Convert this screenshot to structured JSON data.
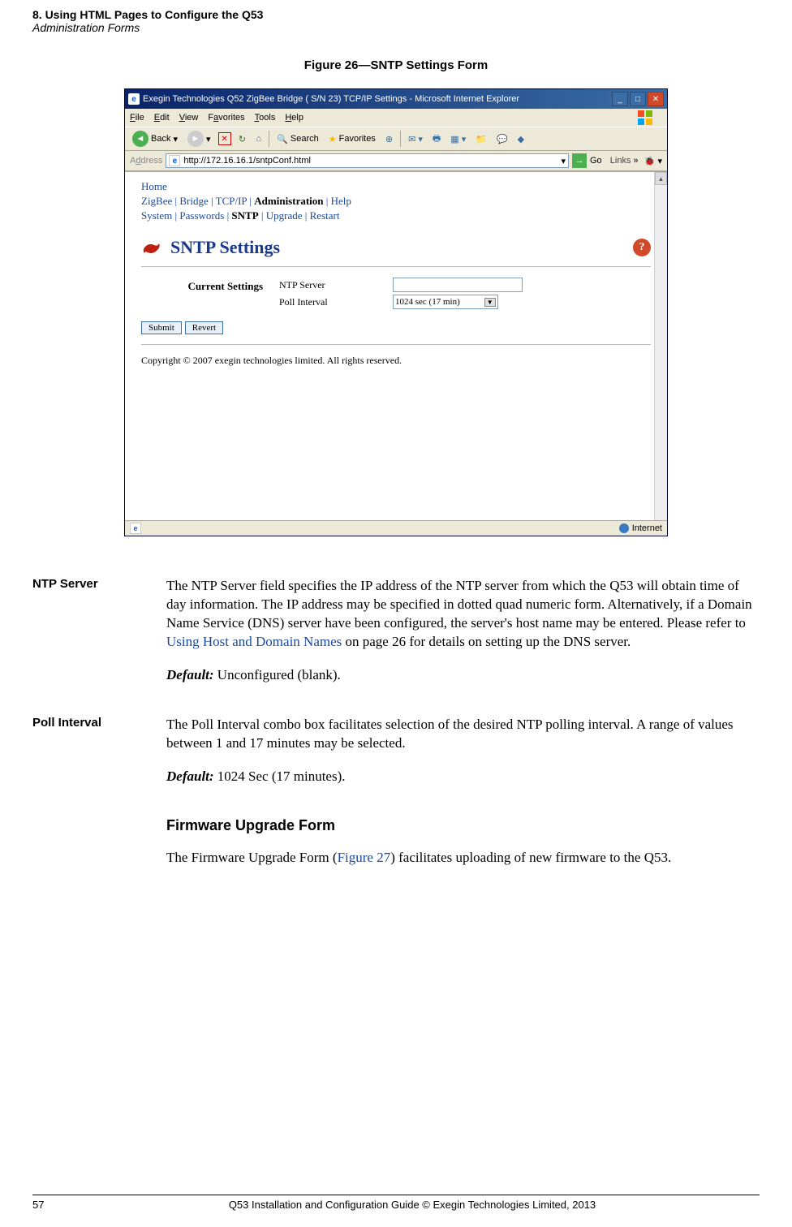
{
  "header": {
    "title": "8. Using HTML Pages to Configure the Q53",
    "subtitle": "Administration Forms"
  },
  "figure_caption": "Figure 26—SNTP Settings Form",
  "ie": {
    "title": "Exegin Technologies Q52 ZigBee Bridge ( S/N 23) TCP/IP Settings - Microsoft Internet Explorer",
    "menu": {
      "file": "File",
      "edit": "Edit",
      "view": "View",
      "favorites": "Favorites",
      "tools": "Tools",
      "help": "Help"
    },
    "toolbar": {
      "back": "Back",
      "search": "Search",
      "favorites": "Favorites"
    },
    "addr": {
      "label": "Address",
      "url": "http://172.16.16.1/sntpConf.html",
      "go": "Go",
      "links": "Links"
    },
    "nav1": {
      "home": "Home"
    },
    "nav2": {
      "zigbee": "ZigBee",
      "bridge": "Bridge",
      "tcpip": "TCP/IP",
      "admin": "Administration",
      "help": "Help"
    },
    "nav3": {
      "system": "System",
      "passwords": "Passwords",
      "sntp": "SNTP",
      "upgrade": "Upgrade",
      "restart": "Restart"
    },
    "page_title": "SNTP Settings",
    "form": {
      "section": "Current Settings",
      "ntp_label": "NTP Server",
      "ntp_value": "",
      "poll_label": "Poll Interval",
      "poll_value": "1024 sec (17 min)",
      "submit": "Submit",
      "revert": "Revert"
    },
    "copyright": "Copyright © 2007 exegin technologies limited. All rights reserved.",
    "status": "Internet"
  },
  "defs": {
    "ntp": {
      "term": "NTP Server",
      "body": "The NTP Server field specifies the IP address of the NTP server from which the Q53 will obtain time of day information. The IP address may be specified in dotted quad numeric form. Alternatively, if a Domain Name Service (DNS) server have been configured, the server's host name may be entered. Please refer to ",
      "link": "Using Host and Domain Names",
      "body2": " on page 26 for details on setting up the DNS server.",
      "default_label": "Default:",
      "default_value": " Unconfigured (blank)."
    },
    "poll": {
      "term": "Poll Interval",
      "body": "The Poll Interval combo box facilitates selection of the desired NTP polling interval. A range of values between 1 and 17 minutes may be selected.",
      "default_label": "Default:",
      "default_value": " 1024 Sec (17 minutes)."
    }
  },
  "section": {
    "heading": "Firmware Upgrade Form",
    "body1": "The Firmware Upgrade Form (",
    "link": "Figure 27",
    "body2": ") facilitates uploading of new firmware to the Q53."
  },
  "footer": {
    "page": "57",
    "text": "Q53 Installation and Configuration Guide  © Exegin Technologies Limited, 2013"
  }
}
